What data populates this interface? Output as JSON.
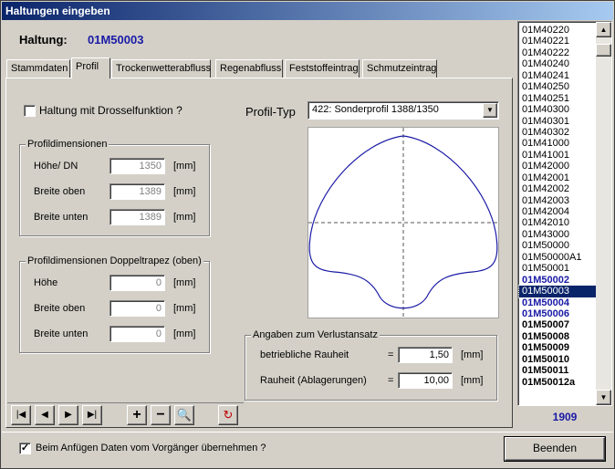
{
  "window": {
    "title": "Haltungen eingeben"
  },
  "header": {
    "label": "Haltung:",
    "value": "01M50003"
  },
  "tabs": [
    "Stammdaten",
    "Profil",
    "Trockenwetterabfluss",
    "Regenabfluss",
    "Feststoffeintrag",
    "Schmutzeintrag"
  ],
  "drossel": {
    "label": "Haltung mit Drosselfunktion ?",
    "checked": ""
  },
  "profildim": {
    "title": "Profildimensionen",
    "rows": [
      {
        "label": "Höhe/ DN",
        "value": "1350",
        "unit": "[mm]"
      },
      {
        "label": "Breite oben",
        "value": "1389",
        "unit": "[mm]"
      },
      {
        "label": "Breite unten",
        "value": "1389",
        "unit": "[mm]"
      }
    ]
  },
  "doppeltrapez": {
    "title": "Profildimensionen Doppeltrapez (oben)",
    "rows": [
      {
        "label": "Höhe",
        "value": "0",
        "unit": "[mm]"
      },
      {
        "label": "Breite oben",
        "value": "0",
        "unit": "[mm]"
      },
      {
        "label": "Breite unten",
        "value": "0",
        "unit": "[mm]"
      }
    ]
  },
  "profiltyp": {
    "label": "Profil-Typ",
    "value": "422: Sonderprofil 1388/1350"
  },
  "verlust": {
    "title": "Angaben zum Verlustansatz",
    "rows": [
      {
        "label": "betriebliche Rauheit",
        "eq": "=",
        "value": "1,50",
        "unit": "[mm]"
      },
      {
        "label": "Rauheit (Ablagerungen)",
        "eq": "=",
        "value": "10,00",
        "unit": "[mm]"
      }
    ]
  },
  "list": {
    "items": [
      {
        "t": "01M40220",
        "s": "n"
      },
      {
        "t": "01M40221",
        "s": "n"
      },
      {
        "t": "01M40222",
        "s": "n"
      },
      {
        "t": "01M40240",
        "s": "n"
      },
      {
        "t": "01M40241",
        "s": "n"
      },
      {
        "t": "01M40250",
        "s": "n"
      },
      {
        "t": "01M40251",
        "s": "n"
      },
      {
        "t": "01M40300",
        "s": "n"
      },
      {
        "t": "01M40301",
        "s": "n"
      },
      {
        "t": "01M40302",
        "s": "n"
      },
      {
        "t": "01M41000",
        "s": "n"
      },
      {
        "t": "01M41001",
        "s": "n"
      },
      {
        "t": "01M42000",
        "s": "n"
      },
      {
        "t": "01M42001",
        "s": "n"
      },
      {
        "t": "01M42002",
        "s": "n"
      },
      {
        "t": "01M42003",
        "s": "n"
      },
      {
        "t": "01M42004",
        "s": "n"
      },
      {
        "t": "01M42010",
        "s": "n"
      },
      {
        "t": "01M43000",
        "s": "n"
      },
      {
        "t": "01M50000",
        "s": "n"
      },
      {
        "t": "01M50000A1",
        "s": "n"
      },
      {
        "t": "01M50001",
        "s": "n"
      },
      {
        "t": "01M50002",
        "s": "blue"
      },
      {
        "t": "01M50003",
        "s": "sel"
      },
      {
        "t": "01M50004",
        "s": "blue"
      },
      {
        "t": "01M50006",
        "s": "blue"
      },
      {
        "t": "01M50007",
        "s": "bold"
      },
      {
        "t": "01M50008",
        "s": "bold"
      },
      {
        "t": "01M50009",
        "s": "bold"
      },
      {
        "t": "01M50010",
        "s": "bold"
      },
      {
        "t": "01M50011",
        "s": "bold"
      },
      {
        "t": "01M50012a",
        "s": "bold"
      }
    ],
    "count": "1909"
  },
  "footer": {
    "checkbox_label": "Beim Anfügen Daten vom Vorgänger übernehmen ?",
    "checked": "✓",
    "close_label": "Beenden"
  },
  "nav": [
    "first-icon",
    "prev-icon",
    "next-icon",
    "last-icon",
    "add-icon",
    "remove-icon",
    "zoom-icon",
    "refresh-icon"
  ]
}
